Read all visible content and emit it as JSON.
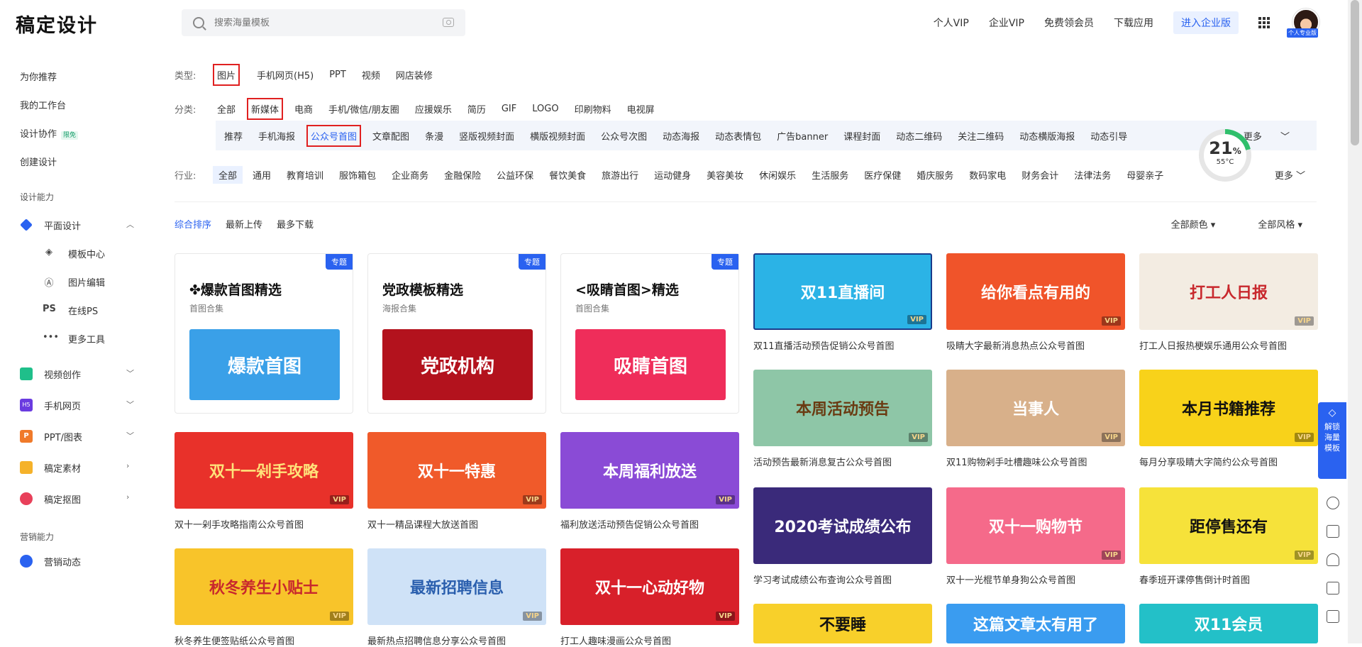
{
  "header": {
    "logo": "稿定设计",
    "search_placeholder": "搜索海量模板",
    "nav": [
      "个人VIP",
      "企业VIP",
      "免费领会员",
      "下载应用"
    ],
    "enterprise_btn": "进入企业版",
    "avatar_badge": "个人专业版"
  },
  "sidebar": {
    "items": [
      "为你推荐",
      "我的工作台",
      "设计协作",
      "创建设计"
    ],
    "collab_badge": "限免",
    "section_design": "设计能力",
    "flat_design": "平面设计",
    "flat_sub": [
      "模板中心",
      "图片编辑",
      "在线PS",
      "更多工具"
    ],
    "flat_sub_icons": [
      "layers-icon",
      "pen-icon",
      "ps-icon",
      "more-icon"
    ],
    "ps_icon_text": "PS",
    "more_icon_text": "•••",
    "others": [
      "视频创作",
      "手机网页",
      "PPT/图表",
      "稿定素材",
      "稿定抠图"
    ],
    "h5_icon_text": "H5",
    "ppt_icon_text": "P",
    "section_marketing": "营销能力",
    "marketing": "营销动态"
  },
  "filters": {
    "type_label": "类型:",
    "types": [
      "图片",
      "手机网页(H5)",
      "PPT",
      "视频",
      "网店装修"
    ],
    "cat_label": "分类:",
    "cats": [
      "全部",
      "新媒体",
      "电商",
      "手机/微信/朋友圈",
      "应援娱乐",
      "简历",
      "GIF",
      "LOGO",
      "印刷物料",
      "电视屏"
    ],
    "subcats": [
      "推荐",
      "手机海报",
      "公众号首图",
      "文章配图",
      "条漫",
      "竖版视频封面",
      "横版视频封面",
      "公众号次图",
      "动态海报",
      "动态表情包",
      "广告banner",
      "课程封面",
      "动态二维码",
      "关注二维码",
      "动态横版海报",
      "动态引导"
    ],
    "more": "更多",
    "ind_label": "行业:",
    "industries": [
      "全部",
      "通用",
      "教育培训",
      "服饰箱包",
      "企业商务",
      "金融保险",
      "公益环保",
      "餐饮美食",
      "旅游出行",
      "运动健身",
      "美容美妆",
      "休闲娱乐",
      "生活服务",
      "医疗保健",
      "婚庆服务",
      "数码家电",
      "财务会计",
      "法律法务",
      "母婴亲子"
    ]
  },
  "sort": {
    "options": [
      "综合排序",
      "最新上传",
      "最多下载"
    ],
    "color": "全部颜色",
    "style": "全部风格"
  },
  "gauge": {
    "percent": "21",
    "percent_sign": "%",
    "temp": "55°C"
  },
  "collections": [
    {
      "tag": "专题",
      "title": "✤爆款首图精选",
      "sub": "首图合集",
      "img_text": "爆款首图",
      "color": "#3aa0e8"
    },
    {
      "tag": "专题",
      "title": "党政模板精选",
      "sub": "海报合集",
      "img_text": "党政机构",
      "color": "#b3121d"
    },
    {
      "tag": "专题",
      "title": "<吸睛首图>精选",
      "sub": "首图合集",
      "img_text": "吸睛首图",
      "color": "#ef2d5a"
    }
  ],
  "templates": [
    {
      "cap": "双11直播活动预告促销公众号首图",
      "text": "双11直播间",
      "bg": "#2bb3e6",
      "fg": "#fff"
    },
    {
      "cap": "吸睛大字最新消息热点公众号首图",
      "text": "给你看点有用的",
      "bg": "#f0542a",
      "fg": "#fff"
    },
    {
      "cap": "打工人日报热梗娱乐通用公众号首图",
      "text": "打工人日报",
      "bg": "#f3ece2",
      "fg": "#c8282d"
    },
    {
      "cap": "活动预告最新消息复古公众号首图",
      "text": "本周活动预告",
      "bg": "#8ec6a7",
      "fg": "#6a3b12"
    },
    {
      "cap": "双11购物剁手吐槽趣味公众号首图",
      "text": "当事人",
      "bg": "#d8b08a",
      "fg": "#fff"
    },
    {
      "cap": "每月分享吸睛大字简约公众号首图",
      "text": "本月书籍推荐",
      "bg": "#f8d21a",
      "fg": "#111"
    },
    {
      "cap": "双十一剁手攻略指南公众号首图",
      "text": "双十一剁手攻略",
      "bg": "#e8312a",
      "fg": "#ffe27a"
    },
    {
      "cap": "双十一精品课程大放送首图",
      "text": "双十一特惠",
      "bg": "#f05a2a",
      "fg": "#fff"
    },
    {
      "cap": "福利放送活动预告促销公众号首图",
      "text": "本周福利放送",
      "bg": "#8a4bd6",
      "fg": "#fff"
    },
    {
      "cap": "学习考试成绩公布查询公众号首图",
      "text": "2020考试成绩公布",
      "bg": "#3a2a7a",
      "fg": "#fff"
    },
    {
      "cap": "双十一光棍节单身狗公众号首图",
      "text": "双十一购物节",
      "bg": "#f56a8a",
      "fg": "#fff"
    },
    {
      "cap": "春季班开课停售倒计时首图",
      "text": "距停售还有",
      "bg": "#f6e23a",
      "fg": "#111"
    },
    {
      "cap": "秋冬养生便签贴纸公众号首图",
      "text": "秋冬养生小贴士",
      "bg": "#f8c42a",
      "fg": "#c8282d"
    },
    {
      "cap": "最新热点招聘信息分享公众号首图",
      "text": "最新招聘信息",
      "bg": "#cfe2f7",
      "fg": "#2a5fae"
    },
    {
      "cap": "打工人趣味漫画公众号首图",
      "text": "双十一心动好物",
      "bg": "#d8202a",
      "fg": "#fff"
    },
    {
      "cap": "",
      "text": "不要睡",
      "bg": "#f8d02a",
      "fg": "#111"
    },
    {
      "cap": "",
      "text": "这篇文章太有用了",
      "bg": "#3a9cf0",
      "fg": "#fff"
    },
    {
      "cap": "",
      "text": "双11会员",
      "bg": "#23c0c8",
      "fg": "#fff"
    }
  ],
  "vip": "VIP",
  "float_btn": "解锁海量模板"
}
